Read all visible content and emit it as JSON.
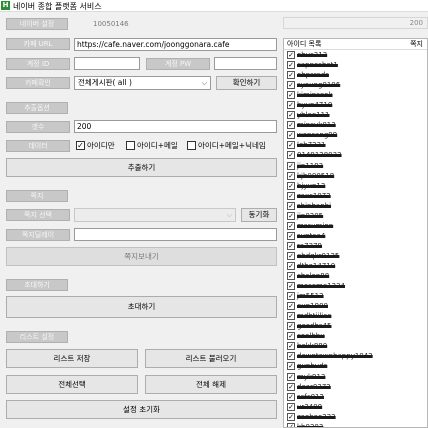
{
  "app": {
    "title": "네이버 종합 플랫폼 서비스",
    "icon_letter": "H"
  },
  "header": {
    "naver_setting_label": "네이버 설정",
    "user_code": "10050146",
    "list_count": "200"
  },
  "cafe": {
    "url_label": "카페 URL",
    "url_value": "https://cafe.naver.com/joonggonara.cafe",
    "account_id_label": "계정 ID",
    "account_pw_label": "계정 PW",
    "cafe_check_label": "카페확인",
    "board_select_value": "전체게시판( all )",
    "check_button": "확인하기"
  },
  "extract": {
    "section_label": "추출옵션",
    "count_label": "갯수",
    "count_value": "200",
    "data_label": "데이터",
    "options": [
      {
        "label": "아이디만",
        "checked": true
      },
      {
        "label": "아이디+메일",
        "checked": false
      },
      {
        "label": "아이디+메일+닉네임",
        "checked": false
      }
    ],
    "button": "추출하기"
  },
  "note": {
    "section_label": "쪽지",
    "select_label": "쪽지 선택",
    "sync_button": "동기화",
    "delay_label": "쪽지딜레이",
    "send_button": "쪽지보내기"
  },
  "invite": {
    "section_label": "초대하기",
    "button": "초대하기"
  },
  "list_settings": {
    "section_label": "리스트 설정",
    "save_button": "리스트 저장",
    "load_button": "리스트 불러오기",
    "select_all_button": "전체선택",
    "deselect_all_button": "전체 해제",
    "reset_button": "설정 초기화"
  },
  "id_list": {
    "header_id": "아이디 목록",
    "header_note": "쪽지",
    "rows": [
      {
        "id": "ohus313",
        "checked": true
      },
      {
        "id": "capnoshot1",
        "checked": true
      },
      {
        "id": "ohpsreds",
        "checked": true
      },
      {
        "id": "syoung0106",
        "checked": true
      },
      {
        "id": "kiminseok",
        "checked": true
      },
      {
        "id": "hyun4710",
        "checked": true
      },
      {
        "id": "yhlee111",
        "checked": true
      },
      {
        "id": "minsuk013",
        "checked": true
      },
      {
        "id": "wonsang99",
        "checked": true
      },
      {
        "id": "leb7231",
        "checked": true
      },
      {
        "id": "0149128032",
        "checked": true
      },
      {
        "id": "jin1193",
        "checked": true
      },
      {
        "id": "kjh000518",
        "checked": true
      },
      {
        "id": "hjyun13",
        "checked": true
      },
      {
        "id": "zaxc1072",
        "checked": true
      },
      {
        "id": "shinhanbi",
        "checked": true
      },
      {
        "id": "jin0305",
        "checked": true
      },
      {
        "id": "mssuminn",
        "checked": true
      },
      {
        "id": "suntae4",
        "checked": true
      },
      {
        "id": "ra7379",
        "checked": true
      },
      {
        "id": "ehdqkr0125",
        "checked": true
      },
      {
        "id": "dtho14710",
        "checked": true
      },
      {
        "id": "chelon88",
        "checked": true
      },
      {
        "id": "mosome1234",
        "checked": true
      },
      {
        "id": "jm5512",
        "checked": true
      },
      {
        "id": "eun1900",
        "checked": true
      },
      {
        "id": "mdhtiilice",
        "checked": true
      },
      {
        "id": "goodhs45",
        "checked": true
      },
      {
        "id": "coolbbu",
        "checked": true
      },
      {
        "id": "bokk880",
        "checked": true
      },
      {
        "id": "downtownhappy1042",
        "checked": true
      },
      {
        "id": "gunbuds",
        "checked": true
      },
      {
        "id": "myk913",
        "checked": true
      },
      {
        "id": "dear0372",
        "checked": true
      },
      {
        "id": "ssfc012",
        "checked": true
      },
      {
        "id": "ur3400",
        "checked": true
      },
      {
        "id": "zooboo222",
        "checked": true
      },
      {
        "id": "kh0303",
        "checked": true
      }
    ]
  }
}
